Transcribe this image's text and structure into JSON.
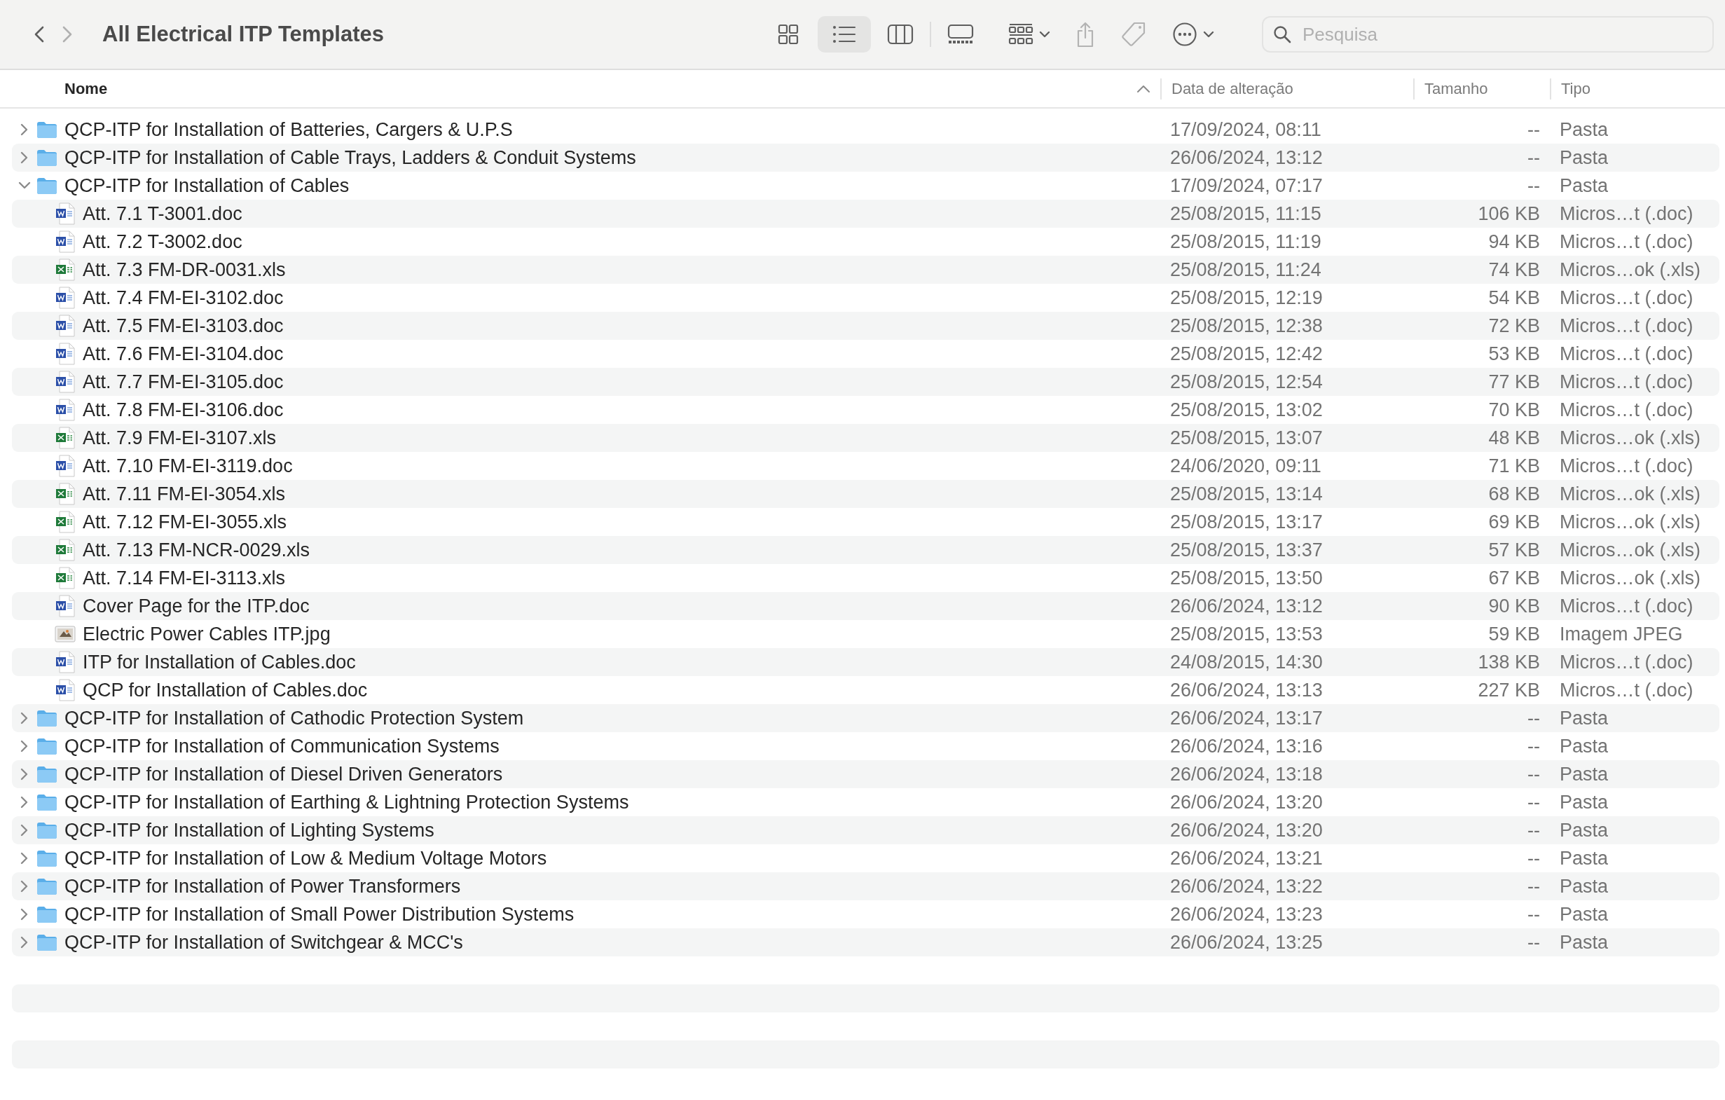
{
  "window": {
    "title": "All Electrical ITP Templates"
  },
  "navigation": [
    {
      "kind": "back",
      "disabled": false
    },
    {
      "kind": "forward",
      "disabled": true
    }
  ],
  "view_modes": [
    {
      "kind": "icons",
      "selected": false
    },
    {
      "kind": "list",
      "selected": true
    },
    {
      "kind": "columns",
      "selected": false
    },
    {
      "kind": "gallery",
      "selected": false
    }
  ],
  "toolbar_buttons": [
    {
      "kind": "group",
      "disabled": false
    },
    {
      "kind": "share",
      "disabled": true
    },
    {
      "kind": "tag",
      "disabled": true
    },
    {
      "kind": "more",
      "disabled": false
    }
  ],
  "search": {
    "placeholder": "Pesquisa"
  },
  "columns": [
    {
      "label": "Nome",
      "sorted": true
    },
    {
      "label": "Data de alteração",
      "sorted": false
    },
    {
      "label": "Tamanho",
      "sorted": false
    },
    {
      "label": "Tipo",
      "sorted": false
    }
  ],
  "rows": [
    {
      "kind": "folder",
      "name": "QCP-ITP for Installation of Batteries, Cargers & U.P.S",
      "date": "17/09/2024, 08:11",
      "size": "--",
      "type": "Pasta",
      "expanded": false
    },
    {
      "kind": "folder",
      "name": "QCP-ITP for Installation of Cable Trays, Ladders & Conduit Systems",
      "date": "26/06/2024, 13:12",
      "size": "--",
      "type": "Pasta",
      "expanded": false
    },
    {
      "kind": "folder",
      "name": "QCP-ITP for Installation of Cables",
      "date": "17/09/2024, 07:17",
      "size": "--",
      "type": "Pasta",
      "expanded": true,
      "children": [
        {
          "kind": "doc",
          "name": "Att. 7.1 T-3001.doc",
          "date": "25/08/2015, 11:15",
          "size": "106 KB",
          "type": "Micros…t (.doc)"
        },
        {
          "kind": "doc",
          "name": "Att. 7.2 T-3002.doc",
          "date": "25/08/2015, 11:19",
          "size": "94 KB",
          "type": "Micros…t (.doc)"
        },
        {
          "kind": "xls",
          "name": "Att. 7.3 FM-DR-0031.xls",
          "date": "25/08/2015, 11:24",
          "size": "74 KB",
          "type": "Micros…ok (.xls)"
        },
        {
          "kind": "doc",
          "name": "Att. 7.4 FM-EI-3102.doc",
          "date": "25/08/2015, 12:19",
          "size": "54 KB",
          "type": "Micros…t (.doc)"
        },
        {
          "kind": "doc",
          "name": "Att. 7.5 FM-EI-3103.doc",
          "date": "25/08/2015, 12:38",
          "size": "72 KB",
          "type": "Micros…t (.doc)"
        },
        {
          "kind": "doc",
          "name": "Att. 7.6 FM-EI-3104.doc",
          "date": "25/08/2015, 12:42",
          "size": "53 KB",
          "type": "Micros…t (.doc)"
        },
        {
          "kind": "doc",
          "name": "Att. 7.7 FM-EI-3105.doc",
          "date": "25/08/2015, 12:54",
          "size": "77 KB",
          "type": "Micros…t (.doc)"
        },
        {
          "kind": "doc",
          "name": "Att. 7.8 FM-EI-3106.doc",
          "date": "25/08/2015, 13:02",
          "size": "70 KB",
          "type": "Micros…t (.doc)"
        },
        {
          "kind": "xls",
          "name": "Att. 7.9 FM-EI-3107.xls",
          "date": "25/08/2015, 13:07",
          "size": "48 KB",
          "type": "Micros…ok (.xls)"
        },
        {
          "kind": "doc",
          "name": "Att. 7.10 FM-EI-3119.doc",
          "date": "24/06/2020, 09:11",
          "size": "71 KB",
          "type": "Micros…t (.doc)"
        },
        {
          "kind": "xls",
          "name": "Att. 7.11 FM-EI-3054.xls",
          "date": "25/08/2015, 13:14",
          "size": "68 KB",
          "type": "Micros…ok (.xls)"
        },
        {
          "kind": "xls",
          "name": "Att. 7.12 FM-EI-3055.xls",
          "date": "25/08/2015, 13:17",
          "size": "69 KB",
          "type": "Micros…ok (.xls)"
        },
        {
          "kind": "xls",
          "name": "Att. 7.13 FM-NCR-0029.xls",
          "date": "25/08/2015, 13:37",
          "size": "57 KB",
          "type": "Micros…ok (.xls)"
        },
        {
          "kind": "xls",
          "name": "Att. 7.14 FM-EI-3113.xls",
          "date": "25/08/2015, 13:50",
          "size": "67 KB",
          "type": "Micros…ok (.xls)"
        },
        {
          "kind": "doc",
          "name": "Cover Page for the ITP.doc",
          "date": "26/06/2024, 13:12",
          "size": "90 KB",
          "type": "Micros…t (.doc)"
        },
        {
          "kind": "jpg",
          "name": "Electric Power Cables ITP.jpg",
          "date": "25/08/2015, 13:53",
          "size": "59 KB",
          "type": "Imagem JPEG"
        },
        {
          "kind": "doc",
          "name": "ITP for Installation of Cables.doc",
          "date": "24/08/2015, 14:30",
          "size": "138 KB",
          "type": "Micros…t (.doc)"
        },
        {
          "kind": "doc",
          "name": "QCP for Installation of Cables.doc",
          "date": "26/06/2024, 13:13",
          "size": "227 KB",
          "type": "Micros…t (.doc)"
        }
      ]
    },
    {
      "kind": "folder",
      "name": "QCP-ITP for Installation of Cathodic Protection System",
      "date": "26/06/2024, 13:17",
      "size": "--",
      "type": "Pasta",
      "expanded": false
    },
    {
      "kind": "folder",
      "name": "QCP-ITP for Installation of Communication Systems",
      "date": "26/06/2024, 13:16",
      "size": "--",
      "type": "Pasta",
      "expanded": false
    },
    {
      "kind": "folder",
      "name": "QCP-ITP for Installation of Diesel Driven Generators",
      "date": "26/06/2024, 13:18",
      "size": "--",
      "type": "Pasta",
      "expanded": false
    },
    {
      "kind": "folder",
      "name": "QCP-ITP for Installation of Earthing & Lightning Protection Systems",
      "date": "26/06/2024, 13:20",
      "size": "--",
      "type": "Pasta",
      "expanded": false
    },
    {
      "kind": "folder",
      "name": "QCP-ITP for Installation of Lighting Systems",
      "date": "26/06/2024, 13:20",
      "size": "--",
      "type": "Pasta",
      "expanded": false
    },
    {
      "kind": "folder",
      "name": "QCP-ITP for Installation of Low & Medium Voltage Motors",
      "date": "26/06/2024, 13:21",
      "size": "--",
      "type": "Pasta",
      "expanded": false
    },
    {
      "kind": "folder",
      "name": "QCP-ITP for Installation of Power Transformers",
      "date": "26/06/2024, 13:22",
      "size": "--",
      "type": "Pasta",
      "expanded": false
    },
    {
      "kind": "folder",
      "name": "QCP-ITP for Installation of Small Power Distribution Systems",
      "date": "26/06/2024, 13:23",
      "size": "--",
      "type": "Pasta",
      "expanded": false
    },
    {
      "kind": "folder",
      "name": "QCP-ITP for Installation of Switchgear & MCC's",
      "date": "26/06/2024, 13:25",
      "size": "--",
      "type": "Pasta",
      "expanded": false
    }
  ]
}
